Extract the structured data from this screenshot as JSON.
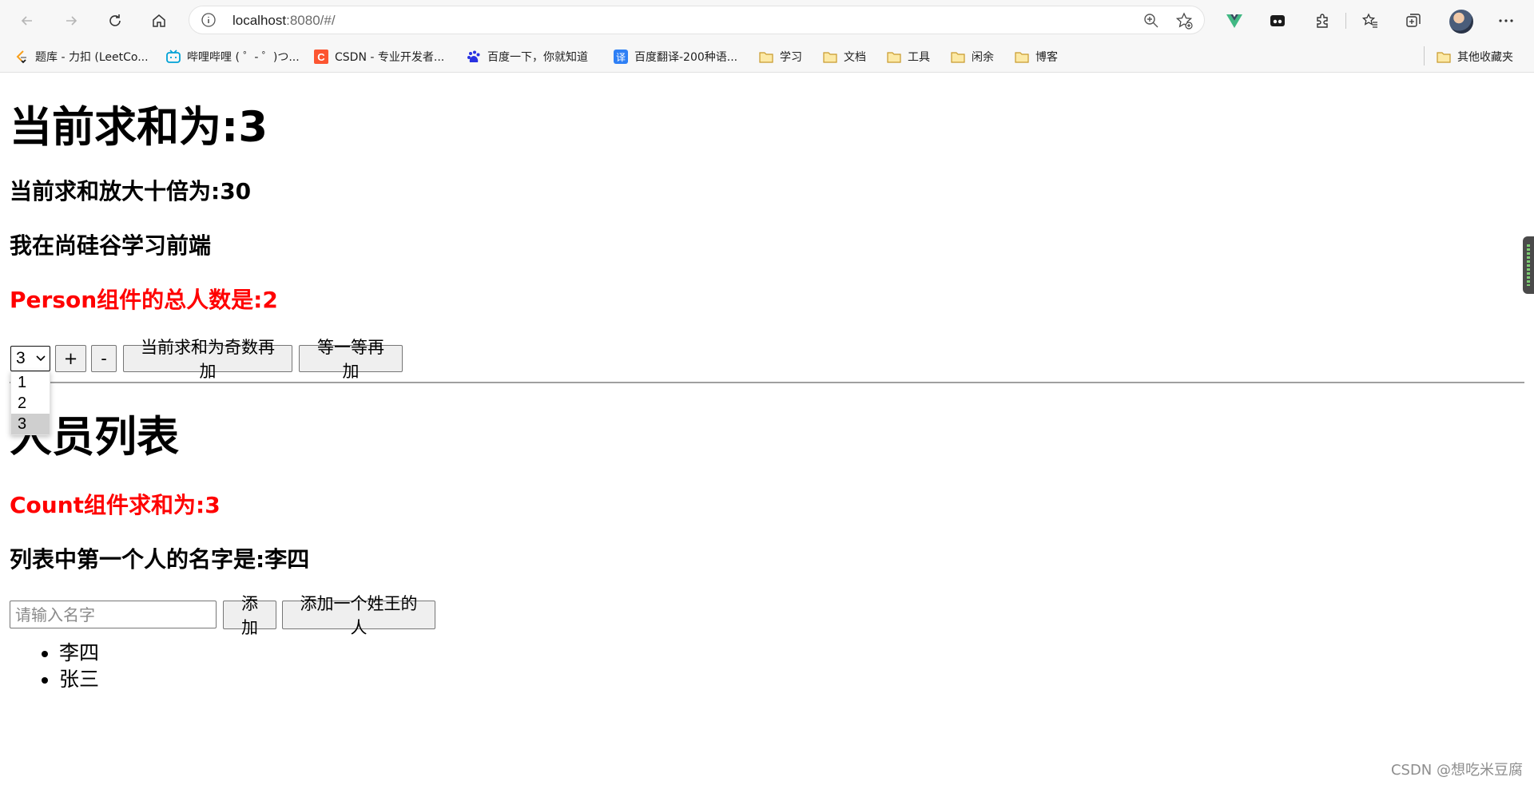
{
  "browser": {
    "url_host": "localhost",
    "url_path": ":8080/#/",
    "bookmarks": [
      {
        "label": "题库 - 力扣 (LeetCo...",
        "icon": "leetcode-icon"
      },
      {
        "label": "哔哩哔哩 ( ゜- ゜)つ...",
        "icon": "bilibili-icon"
      },
      {
        "label": "CSDN - 专业开发者...",
        "icon": "csdn-icon"
      },
      {
        "label": "百度一下，你就知道",
        "icon": "baidu-icon"
      },
      {
        "label": "百度翻译-200种语...",
        "icon": "baidu-translate-icon"
      },
      {
        "label": "学习",
        "icon": "folder-icon"
      },
      {
        "label": "文档",
        "icon": "folder-icon"
      },
      {
        "label": "工具",
        "icon": "folder-icon"
      },
      {
        "label": "闲余",
        "icon": "folder-icon"
      },
      {
        "label": "博客",
        "icon": "folder-icon"
      }
    ],
    "other_bookmarks": "其他收藏夹"
  },
  "count": {
    "sum_heading": "当前求和为:3",
    "big_sum_heading": "当前求和放大十倍为:30",
    "school_heading": "我在尚硅谷学习前端",
    "person_total_heading": "Person组件的总人数是:2",
    "select": {
      "value": "3",
      "options": [
        "1",
        "2",
        "3"
      ],
      "highlighted": "3"
    },
    "buttons": {
      "increment": "+",
      "decrement": "-",
      "increment_odd": "当前求和为奇数再加",
      "increment_wait": "等一等再加"
    }
  },
  "person": {
    "title": "人员列表",
    "count_sum_heading": "Count组件求和为:3",
    "first_person_heading": "列表中第一个人的名字是:李四",
    "input_placeholder": "请输入名字",
    "buttons": {
      "add": "添加",
      "add_wang": "添加一个姓王的人"
    },
    "people": [
      "李四",
      "张三"
    ]
  },
  "watermark": "CSDN @想吃米豆腐",
  "colors": {
    "highlight_text": "#ff0000",
    "vue_green": "#41b883",
    "folder_yellow": "#e8b93b"
  }
}
